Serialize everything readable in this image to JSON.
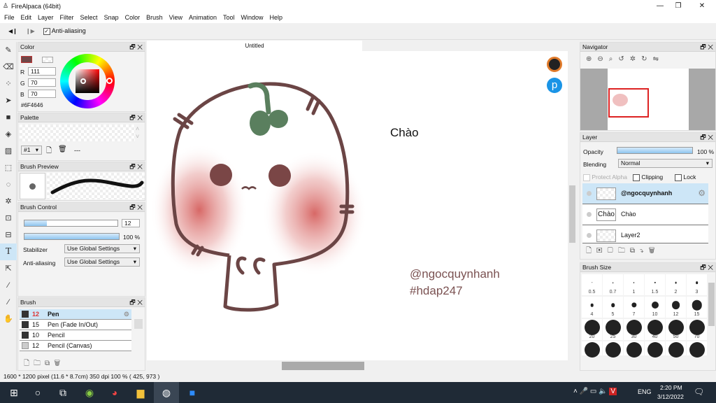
{
  "window": {
    "title": "FireAlpaca (64bit)",
    "minimize": "—",
    "maximize": "❐",
    "close": "✕"
  },
  "menu": [
    "File",
    "Edit",
    "Layer",
    "Filter",
    "Select",
    "Snap",
    "Color",
    "Brush",
    "View",
    "Animation",
    "Tool",
    "Window",
    "Help"
  ],
  "toolbar": {
    "prev": "◀❙",
    "next": "❙▶",
    "antialias_label": "Anti-aliasing",
    "antialias_checked": true
  },
  "tools": [
    "pen-icon",
    "eraser-icon",
    "dot-icon",
    "move-icon",
    "fill-rect-icon",
    "bucket-icon",
    "gradient-icon",
    "select-rect-icon",
    "lasso-icon",
    "magic-wand-icon",
    "select-pen-icon",
    "select-eraser-icon",
    "text-icon",
    "operation-icon",
    "blur-icon",
    "eyedropper-icon",
    "hand-icon"
  ],
  "color_panel": {
    "title": "Color",
    "r_label": "R",
    "r": "111",
    "g_label": "G",
    "g": "70",
    "b_label": "B",
    "b": "70",
    "hex": "#6F4646",
    "primary": "#6F4646"
  },
  "palette_panel": {
    "title": "Palette",
    "index": "#1",
    "separator": "---"
  },
  "brush_preview": {
    "title": "Brush Preview"
  },
  "brush_control": {
    "title": "Brush Control",
    "size": "12",
    "size_fraction": 0.24,
    "opacity": "100 %",
    "opacity_fraction": 1.0,
    "stabilizer_label": "Stabilizer",
    "stabilizer": "Use Global Settings",
    "antialias_label": "Anti-aliasing",
    "antialias": "Use Global Settings"
  },
  "brush_panel": {
    "title": "Brush",
    "items": [
      {
        "size": "12",
        "name": "Pen",
        "selected": true
      },
      {
        "size": "15",
        "name": "Pen (Fade In/Out)"
      },
      {
        "size": "10",
        "name": "Pencil"
      },
      {
        "size": "12",
        "name": "Pencil (Canvas)"
      }
    ]
  },
  "canvas": {
    "tab": "Untitled",
    "text_hello": "Chào",
    "text_handle": "@ngocquynhanh",
    "text_tag": "#hdap247"
  },
  "navigator": {
    "title": "Navigator"
  },
  "layer_panel": {
    "title": "Layer",
    "opacity_label": "Opacity",
    "opacity": "100 %",
    "blending_label": "Blending",
    "blending": "Normal",
    "protect_alpha": "Protect Alpha",
    "clipping": "Clipping",
    "lock": "Lock",
    "layers": [
      {
        "name": "@ngocquynhanh",
        "thumb": "",
        "selected": true
      },
      {
        "name": "Chào",
        "thumb": "Chào"
      },
      {
        "name": "Layer2",
        "thumb": ""
      }
    ]
  },
  "brush_size": {
    "title": "Brush Size",
    "sizes": [
      "0.5",
      "0.7",
      "1",
      "1.5",
      "2",
      "3",
      "4",
      "5",
      "7",
      "10",
      "12",
      "15",
      "20",
      "25",
      "30",
      "40",
      "50",
      "70"
    ]
  },
  "status": "1600 * 1200 pixel  (11.6 * 8.7cm)  350 dpi  100 %  ( 425, 973 )",
  "taskbar": {
    "lang": "ENG",
    "time": "2:20 PM",
    "date": "3/12/2022"
  }
}
